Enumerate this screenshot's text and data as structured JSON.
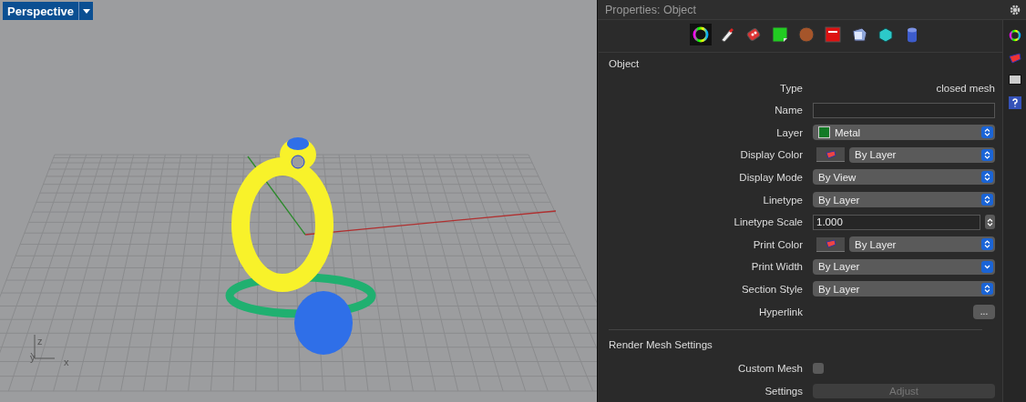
{
  "viewport": {
    "title": "Perspective",
    "axes": [
      "z",
      "y",
      "x"
    ]
  },
  "properties": {
    "title": "Properties: Object",
    "tabs": [
      {
        "kind": "wheel",
        "selected": true
      },
      {
        "kind": "tube",
        "selected": false
      },
      {
        "kind": "decal",
        "selected": false
      },
      {
        "kind": "texture",
        "selected": false
      },
      {
        "kind": "sphere",
        "selected": false
      },
      {
        "kind": "box",
        "selected": false
      },
      {
        "kind": "bevel",
        "selected": false
      },
      {
        "kind": "block",
        "selected": false
      },
      {
        "kind": "cylinder",
        "selected": false
      }
    ],
    "sections": [
      {
        "title": "Object",
        "rows": [
          {
            "label": "Type",
            "kind": "text",
            "value": "closed mesh"
          },
          {
            "label": "Name",
            "kind": "input"
          },
          {
            "label": "Layer",
            "kind": "select",
            "value": "Metal",
            "color": "#137a26"
          },
          {
            "label": "Display Color",
            "kind": "color_select",
            "value": "By Layer"
          },
          {
            "label": "Display Mode",
            "kind": "select",
            "value": "By View"
          },
          {
            "label": "Linetype",
            "kind": "select",
            "value": "By Layer"
          },
          {
            "label": "Linetype Scale",
            "kind": "number",
            "value": "1.000"
          },
          {
            "label": "Print Color",
            "kind": "color_select",
            "value": "By Layer"
          },
          {
            "label": "Print Width",
            "kind": "popup",
            "value": "By Layer"
          },
          {
            "label": "Section Style",
            "kind": "select",
            "value": "By Layer"
          },
          {
            "label": "Hyperlink",
            "kind": "button",
            "value": "..."
          }
        ]
      },
      {
        "title": "Render Mesh Settings",
        "rows": [
          {
            "label": "Custom Mesh",
            "kind": "checkbox",
            "checked": false
          },
          {
            "label": "Settings",
            "kind": "button_wide",
            "value": "Adjust",
            "disabled": true
          }
        ]
      }
    ]
  },
  "side_tabs": [
    {
      "kind": "wheel"
    },
    {
      "kind": "color"
    },
    {
      "kind": "screen"
    },
    {
      "kind": "help"
    }
  ]
}
